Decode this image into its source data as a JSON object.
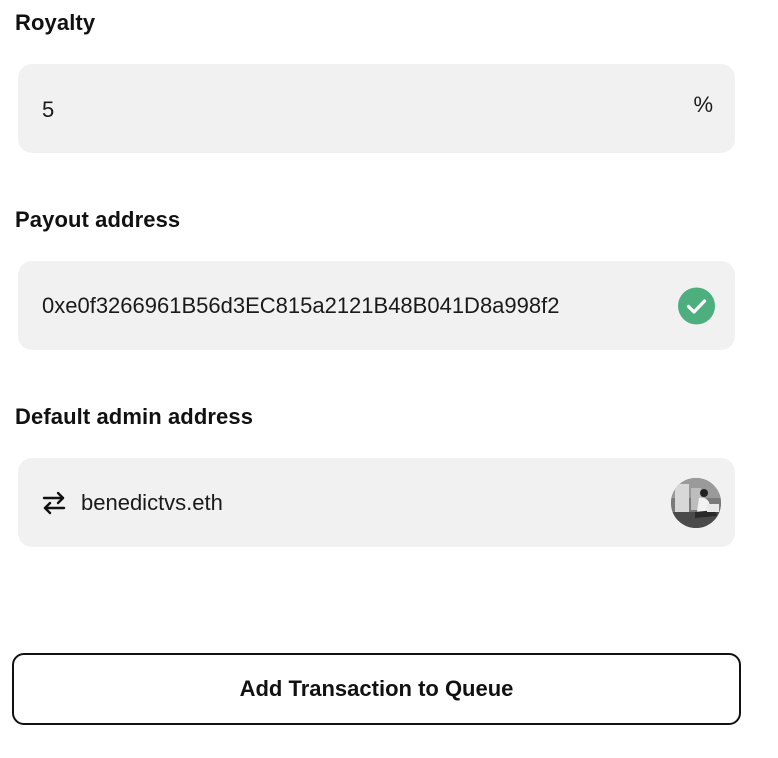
{
  "royalty": {
    "label": "Royalty",
    "value": "5",
    "suffix": "%"
  },
  "payout": {
    "label": "Payout address",
    "value": "0xe0f3266961B56d3EC815a2121B48B041D8a998f2",
    "valid_icon": "check-circle-icon",
    "valid_color": "#4caf7d"
  },
  "admin": {
    "label": "Default admin address",
    "value": "benedictvs.eth",
    "switch_icon": "swap-arrows-icon",
    "avatar": "profile-avatar"
  },
  "actions": {
    "submit_label": "Add Transaction to Queue"
  },
  "theme": {
    "field_bg": "#f1f1f1",
    "text": "#111111",
    "success": "#4caf7d"
  }
}
